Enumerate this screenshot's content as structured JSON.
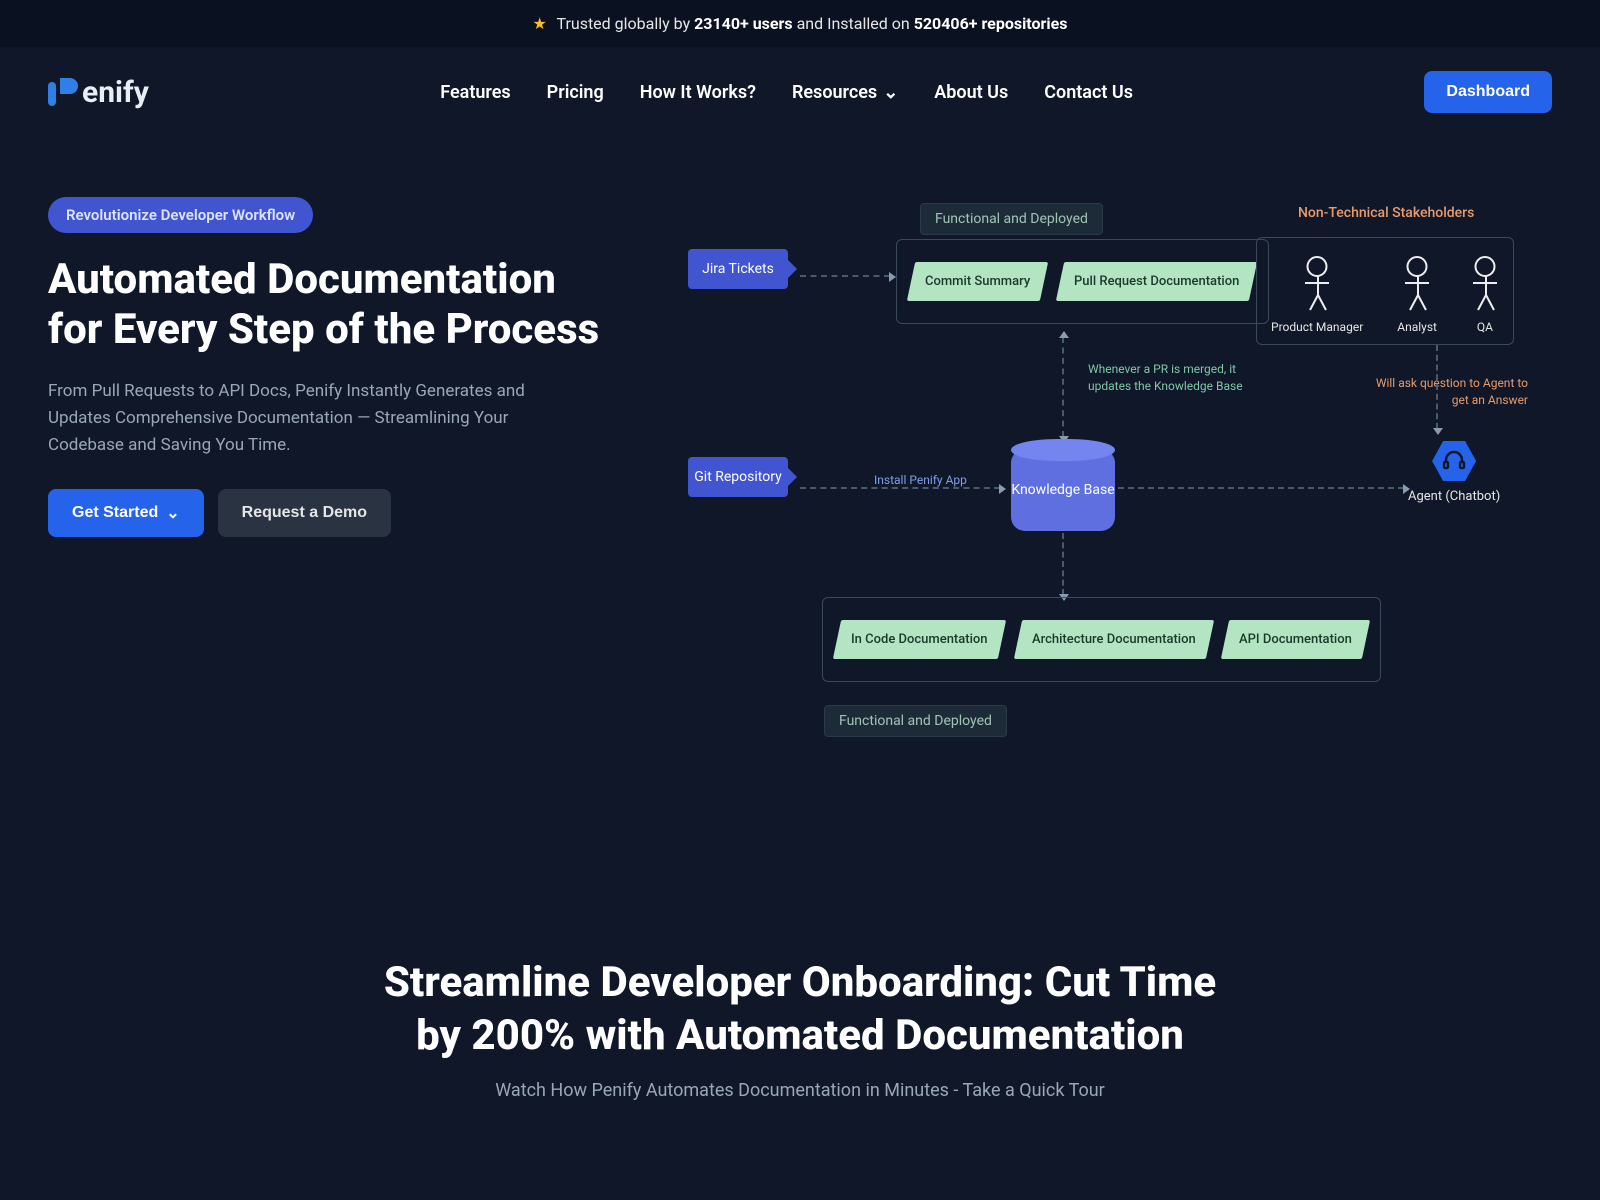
{
  "announcement": {
    "prefix": "Trusted globally by ",
    "users": "23140+ users",
    "mid": " and Installed on ",
    "repos": "520406+ repositories"
  },
  "brand": "enify",
  "nav": {
    "features": "Features",
    "pricing": "Pricing",
    "how": "How It Works?",
    "resources": "Resources",
    "about": "About Us",
    "contact": "Contact Us"
  },
  "dashboard_btn": "Dashboard",
  "hero": {
    "tag": "Revolutionize Developer Workflow",
    "title": "Automated Documentation for Every Step of the Process",
    "desc": "From Pull Requests to API Docs, Penify Instantly Generates and Updates Comprehensive Documentation — Streamlining Your Codebase and Saving You Time.",
    "get_started": "Get Started",
    "request_demo": "Request a Demo"
  },
  "diagram": {
    "functional_deployed": "Functional and Deployed",
    "jira": "Jira Tickets",
    "git": "Git Repository",
    "commit_summary": "Commit Summary",
    "pr_doc": "Pull Request Documentation",
    "kb": "Knowledge Base",
    "install_note": "Install Penify App",
    "merge_note": "Whenever a PR is merged, it updates the Knowledge Base",
    "ask_note": "Will ask question to Agent to get an Answer",
    "incode": "In Code Documentation",
    "arch": "Architecture Documentation",
    "api": "API Documentation",
    "stakeholders_title": "Non-Technical Stakeholders",
    "pm": "Product Manager",
    "analyst": "Analyst",
    "qa": "QA",
    "agent": "Agent (Chatbot)"
  },
  "section2": {
    "title": "Streamline Developer Onboarding: Cut Time by 200% with Automated Documentation",
    "sub": "Watch How Penify Automates Documentation in Minutes - Take a Quick Tour"
  }
}
